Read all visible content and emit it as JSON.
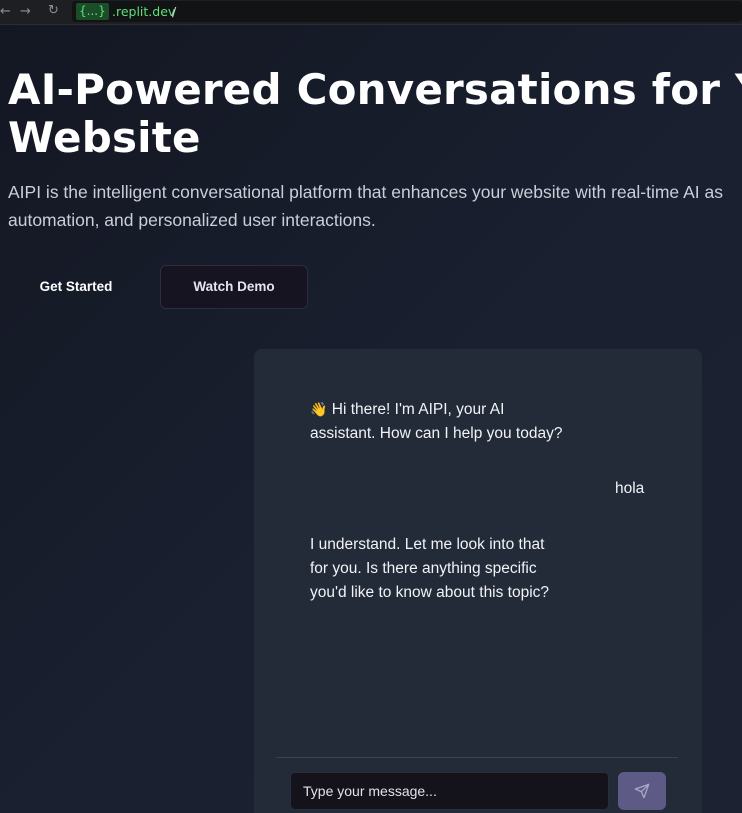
{
  "browser": {
    "back_glyph": "←",
    "forward_glyph": "→",
    "reload_glyph": "↻",
    "url_badge": "{...}",
    "url_domain": ".replit.dev",
    "url_path": "/"
  },
  "hero": {
    "title_line_1": "AI-Powered Conversations for Y",
    "title_line_2": "Website",
    "subtitle_line_1": "AIPI is the intelligent conversational platform that enhances your website with real-time AI as",
    "subtitle_line_2": "automation, and personalized user interactions.",
    "primary_button": "Get Started",
    "secondary_button": "Watch Demo"
  },
  "chat": {
    "messages": [
      {
        "sender": "assistant",
        "emoji": "👋",
        "lines": [
          "Hi there! I'm AIPI, your AI",
          "assistant. How can I help you today?"
        ]
      },
      {
        "sender": "user",
        "lines": [
          "hola"
        ]
      },
      {
        "sender": "assistant",
        "lines": [
          "I understand. Let me look into that",
          "for you. Is there anything specific",
          "you'd like to know about this topic?"
        ]
      }
    ],
    "input_placeholder": "Type your message...",
    "send_icon": "send-icon"
  },
  "colors": {
    "background": "#151a26",
    "chat_panel": "#232a38",
    "send_button": "#5d5a86",
    "url_green": "#5ee07a"
  }
}
